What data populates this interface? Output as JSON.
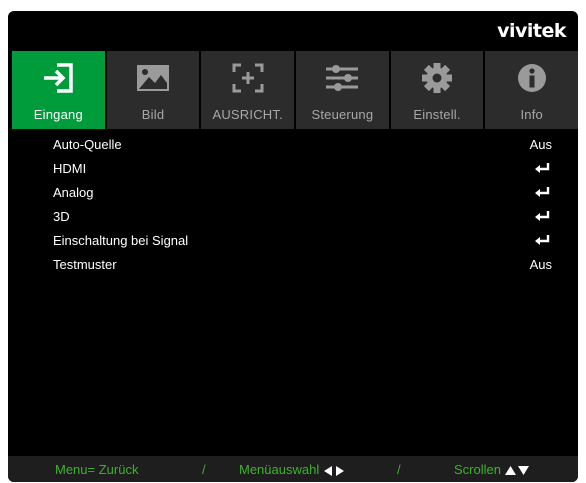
{
  "brand": {
    "logo": "vivitek"
  },
  "tabs": [
    {
      "label": "Eingang",
      "icon": "input-arrow-icon",
      "active": true
    },
    {
      "label": "Bild",
      "icon": "picture-icon",
      "active": false
    },
    {
      "label": "AUSRICHT.",
      "icon": "alignment-frame-icon",
      "active": false
    },
    {
      "label": "Steuerung",
      "icon": "sliders-icon",
      "active": false
    },
    {
      "label": "Einstell.",
      "icon": "gear-icon",
      "active": false
    },
    {
      "label": "Info",
      "icon": "info-icon",
      "active": false
    }
  ],
  "menu": [
    {
      "label": "Auto-Quelle",
      "value": "Aus"
    },
    {
      "label": "HDMI",
      "value": null,
      "icon": "enter-icon"
    },
    {
      "label": "Analog",
      "value": null,
      "icon": "enter-icon"
    },
    {
      "label": "3D",
      "value": null,
      "icon": "enter-icon"
    },
    {
      "label": "Einschaltung bei Signal",
      "value": null,
      "icon": "enter-icon"
    },
    {
      "label": "Testmuster",
      "value": "Aus"
    }
  ],
  "footer": {
    "back": "Menu= Zurück",
    "sep1": "/",
    "select": "Menüauswahl",
    "sep2": "/",
    "scroll": "Scrollen"
  },
  "colors": {
    "accent": "#009c3b",
    "tab_bg": "#2c2c2c",
    "footer_text": "#3fb12f",
    "background": "#000000"
  }
}
